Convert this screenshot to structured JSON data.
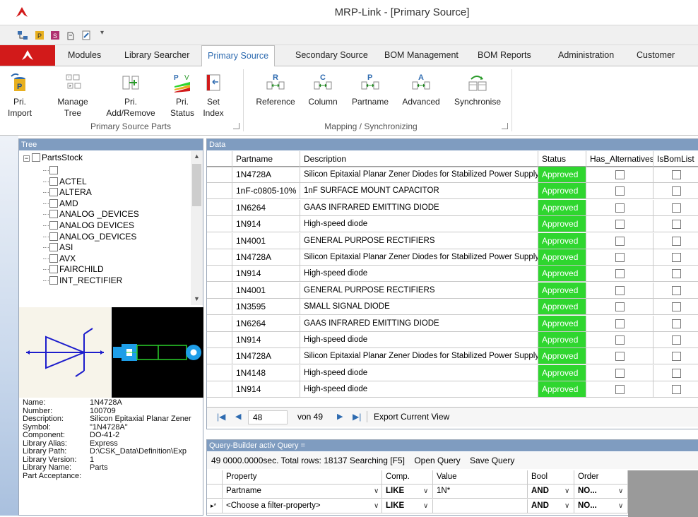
{
  "window": {
    "title": "MRP-Link - [Primary Source]"
  },
  "colors": {
    "accent": "#d21a1a",
    "approved": "#2fd62f",
    "panel_header": "#7f9cc0",
    "active_tab_text": "#2e6bb0"
  },
  "tabs": [
    "Modules",
    "Library Searcher",
    "Primary Source",
    "Secondary Source",
    "BOM Management",
    "BOM Reports",
    "Administration",
    "Customer"
  ],
  "active_tab": "Primary Source",
  "ribbon": {
    "group1": {
      "label": "Primary Source Parts",
      "buttons": [
        {
          "l1": "Pri.",
          "l2": "Import"
        },
        {
          "l1": "Manage",
          "l2": "Tree"
        },
        {
          "l1": "Pri.",
          "l2": "Add/Remove"
        },
        {
          "l1": "Pri.",
          "l2": "Status"
        },
        {
          "l1": "Set",
          "l2": "Index"
        }
      ]
    },
    "group2": {
      "label": "Mapping / Synchronizing",
      "buttons": [
        "Reference",
        "Column",
        "Partname",
        "Advanced",
        "Synchronise"
      ],
      "icon_letters": [
        "R",
        "C",
        "P",
        "A",
        ""
      ]
    }
  },
  "tree": {
    "header": "Tree",
    "root": "PartsStock",
    "items": [
      "",
      "ACTEL",
      "ALTERA",
      "AMD",
      "ANALOG _DEVICES",
      "ANALOG DEVICES",
      "ANALOG_DEVICES",
      "ASI",
      "AVX",
      "FAIRCHILD",
      "INT_RECTIFIER"
    ]
  },
  "properties": [
    {
      "k": "Name:",
      "v": "1N4728A"
    },
    {
      "k": "Number:",
      "v": "100709"
    },
    {
      "k": "Description:",
      "v": "Silicon Epitaxial Planar Zener"
    },
    {
      "k": "Symbol:",
      "v": "\"1N4728A\""
    },
    {
      "k": "Component:",
      "v": "DO-41-2"
    },
    {
      "k": "Library Alias:",
      "v": "Express"
    },
    {
      "k": "Library Path:",
      "v": "D:\\CSK_Data\\Definition\\Exp"
    },
    {
      "k": "Library Version:",
      "v": "1"
    },
    {
      "k": "Library Name:",
      "v": "Parts"
    },
    {
      "k": "Part Acceptance:",
      "v": ""
    }
  ],
  "data": {
    "header": "Data",
    "columns": [
      "Partname",
      "Description",
      "Status",
      "Has_Alternatives",
      "IsBomList"
    ],
    "rows": [
      {
        "partname": "1N4728A",
        "description": "Silicon Epitaxial Planar Zener Diodes for Stabilized Power Supply",
        "status": "Approved"
      },
      {
        "partname": "1nF-c0805-10%",
        "description": "1nF SURFACE MOUNT CAPACITOR",
        "status": "Approved"
      },
      {
        "partname": "1N6264",
        "description": "GAAS INFRARED EMITTING DIODE",
        "status": "Approved"
      },
      {
        "partname": "1N914",
        "description": "High-speed diode",
        "status": "Approved"
      },
      {
        "partname": "1N4001",
        "description": "GENERAL PURPOSE RECTIFIERS",
        "status": "Approved"
      },
      {
        "partname": "1N4728A",
        "description": "Silicon Epitaxial Planar Zener Diodes for Stabilized Power Supply",
        "status": "Approved"
      },
      {
        "partname": "1N914",
        "description": "High-speed diode",
        "status": "Approved"
      },
      {
        "partname": "1N4001",
        "description": "GENERAL PURPOSE RECTIFIERS",
        "status": "Approved"
      },
      {
        "partname": "1N3595",
        "description": "SMALL SIGNAL DIODE",
        "status": "Approved"
      },
      {
        "partname": "1N6264",
        "description": "GAAS INFRARED EMITTING DIODE",
        "status": "Approved"
      },
      {
        "partname": "1N914",
        "description": "High-speed diode",
        "status": "Approved"
      },
      {
        "partname": "1N4728A",
        "description": "Silicon Epitaxial Planar Zener Diodes for Stabilized Power Supply",
        "status": "Approved"
      },
      {
        "partname": "1N4148",
        "description": "High-speed diode",
        "status": "Approved"
      },
      {
        "partname": "1N914",
        "description": "High-speed diode",
        "status": "Approved"
      }
    ],
    "nav": {
      "current": "48",
      "of_text": "von 49",
      "export": "Export Current View"
    }
  },
  "query": {
    "header": "Query-Builder activ Query =",
    "status": "49 0000.0000sec.  Total rows: 18137  Searching [F5]",
    "open": "Open Query",
    "save": "Save Query",
    "columns": [
      "Property",
      "Comp.",
      "Value",
      "Bool",
      "Order"
    ],
    "rows": [
      {
        "property": "Partname",
        "comp": "LIKE",
        "value": "1N*",
        "bool": "AND",
        "order": "NO..."
      },
      {
        "property": "<Choose a filter-property>",
        "comp": "LIKE",
        "value": "",
        "bool": "AND",
        "order": "NO..."
      }
    ]
  }
}
